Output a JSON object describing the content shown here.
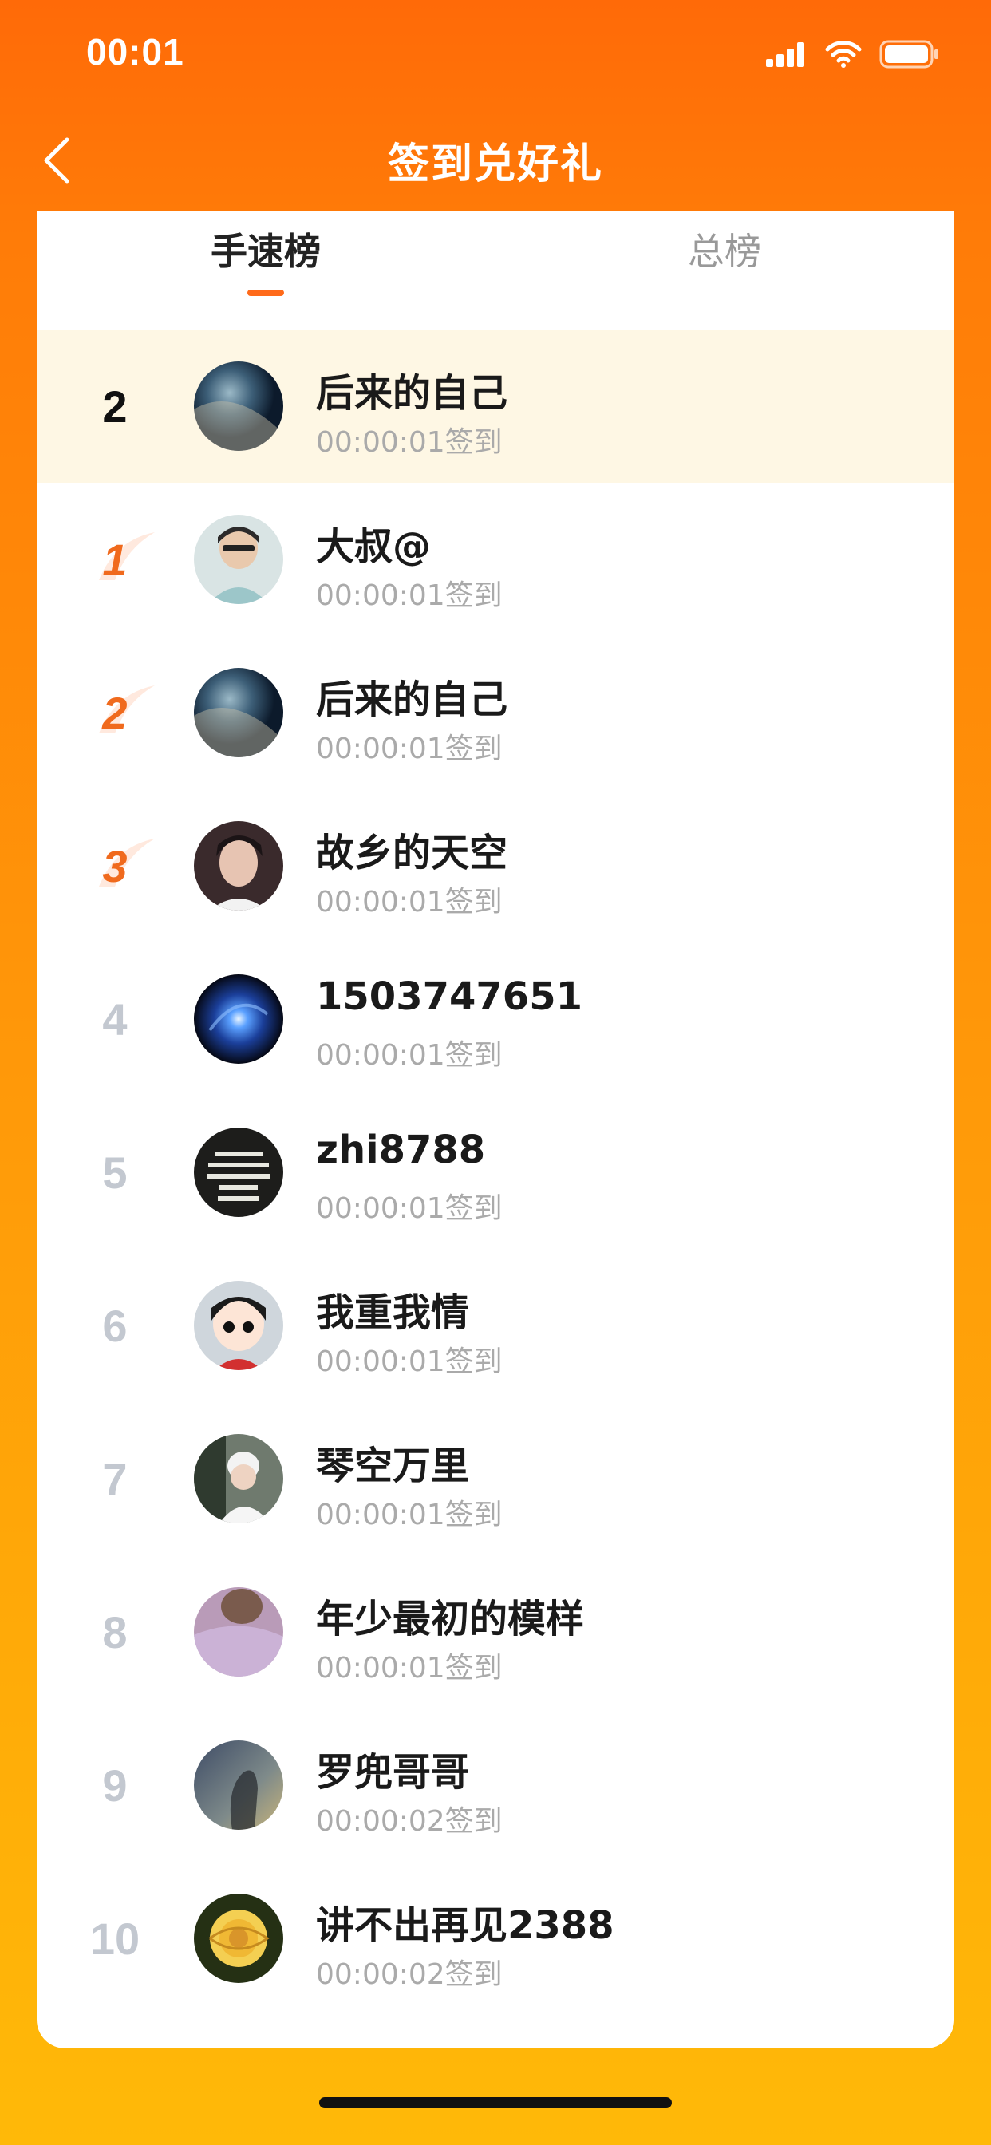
{
  "status_bar": {
    "time": "00:01"
  },
  "nav": {
    "title": "签到兑好礼"
  },
  "tabs": [
    {
      "label": "手速榜",
      "active": true
    },
    {
      "label": "总榜",
      "active": false
    }
  ],
  "my_rank": {
    "rank": "2",
    "name": "后来的自己",
    "time": "00:00:01签到",
    "avatar": "earth-avatar"
  },
  "ranking": [
    {
      "rank": "1",
      "name": "大叔@",
      "time": "00:00:01签到",
      "avatar": "boy-photo-avatar"
    },
    {
      "rank": "2",
      "name": "后来的自己",
      "time": "00:00:01签到",
      "avatar": "earth-avatar"
    },
    {
      "rank": "3",
      "name": "故乡的天空",
      "time": "00:00:01签到",
      "avatar": "man-portrait-avatar"
    },
    {
      "rank": "4",
      "name": "1503747651",
      "time": "00:00:01签到",
      "avatar": "galaxy-avatar"
    },
    {
      "rank": "5",
      "name": "zhi8788",
      "time": "00:00:01签到",
      "avatar": "text-image-avatar"
    },
    {
      "rank": "6",
      "name": "我重我情",
      "time": "00:00:01签到",
      "avatar": "cartoon-avatar"
    },
    {
      "rank": "7",
      "name": "琴空万里",
      "time": "00:00:01签到",
      "avatar": "child-photo-avatar"
    },
    {
      "rank": "8",
      "name": "年少最初的模样",
      "time": "00:00:01签到",
      "avatar": "purple-shirt-avatar"
    },
    {
      "rank": "9",
      "name": "罗兜哥哥",
      "time": "00:00:02签到",
      "avatar": "silhouette-avatar"
    },
    {
      "rank": "10",
      "name": "讲不出再见2388",
      "time": "00:00:02签到",
      "avatar": "flower-avatar"
    }
  ],
  "colors": {
    "accent": "#ff6a1a",
    "header_top": "#ff6a08",
    "page_bottom": "#ffb908",
    "highlight_row": "#fef7e4",
    "rank_gray": "#c3c8d0"
  }
}
